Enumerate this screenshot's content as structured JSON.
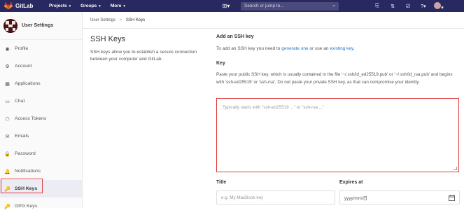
{
  "navbar": {
    "brand": "GitLab",
    "menu": [
      {
        "label": "Projects",
        "caret": "▾"
      },
      {
        "label": "Groups",
        "caret": "▾"
      },
      {
        "label": "More",
        "caret": "▾"
      }
    ],
    "plus_icon": "plus-icon",
    "search_placeholder": "Search or jump to...",
    "search_icon": "search-icon",
    "right_icons": [
      "merge-requests-icon",
      "issues-icon",
      "todos-icon",
      "help-icon",
      "user-avatar"
    ],
    "bg_color": "#292961"
  },
  "sidebar": {
    "title": "User Settings",
    "items": [
      {
        "label": "Profile",
        "icon": "profile-icon",
        "glyph": "◉",
        "active": false
      },
      {
        "label": "Account",
        "icon": "account-icon",
        "glyph": "⚙",
        "active": false
      },
      {
        "label": "Applications",
        "icon": "applications-icon",
        "glyph": "▦",
        "active": false
      },
      {
        "label": "Chat",
        "icon": "chat-icon",
        "glyph": "▭",
        "active": false
      },
      {
        "label": "Access Tokens",
        "icon": "access-tokens-icon",
        "glyph": "⬡",
        "active": false
      },
      {
        "label": "Emails",
        "icon": "emails-icon",
        "glyph": "✉",
        "active": false
      },
      {
        "label": "Password",
        "icon": "password-icon",
        "glyph": "🔒",
        "active": false
      },
      {
        "label": "Notifications",
        "icon": "notifications-icon",
        "glyph": "🔔",
        "active": false
      },
      {
        "label": "SSH Keys",
        "icon": "key-icon",
        "glyph": "🔑",
        "active": true
      },
      {
        "label": "GPG Keys",
        "icon": "gpg-key-icon",
        "glyph": "🔑",
        "active": false
      }
    ],
    "highlight_color": "#e03b3b"
  },
  "breadcrumb": {
    "parent": "User Settings",
    "separator": ">",
    "current": "SSH Keys"
  },
  "page": {
    "title": "SSH Keys",
    "description": "SSH keys allow you to establish a secure connection between your computer and GitLab."
  },
  "form": {
    "section_title": "Add an SSH key",
    "intro_prefix": "To add an SSH key you need to ",
    "intro_link1": "generate one",
    "intro_mid": " or use an ",
    "intro_link2": "existing key",
    "intro_suffix": ".",
    "key_label": "Key",
    "key_help": "Paste your public SSH key, which is usually contained in the file '~/.ssh/id_ed25519.pub' or '~/.ssh/id_rsa.pub' and begins with 'ssh-ed25519' or 'ssh-rsa'. Do not paste your private SSH key, as that can compromise your identity.",
    "key_placeholder": "Typically starts with \"ssh-ed25519 ...\" or \"ssh-rsa ...\"",
    "title_label": "Title",
    "title_placeholder": "e.g. My MacBook key",
    "expires_label": "Expires at",
    "expires_placeholder": "yyyy/mm/日",
    "calendar_icon": "calendar-icon",
    "link_color": "#1f78d1"
  }
}
